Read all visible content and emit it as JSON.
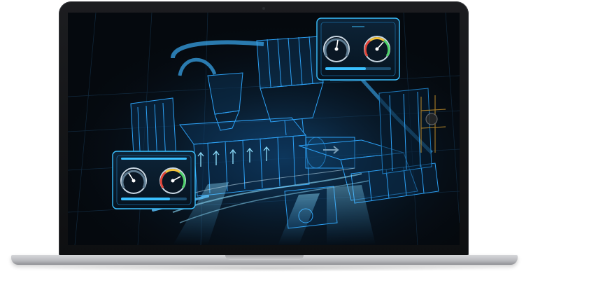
{
  "scene": {
    "subject": "laptop-mockup",
    "screen_content": "industrial-machine-hologram",
    "colors": {
      "screen_bg": "#05090e",
      "hologram": "#2fa8ff",
      "hologram_bright": "#8fe0ff",
      "gauge_red": "#e2463a",
      "gauge_green": "#4ed36a",
      "gauge_yellow": "#f2c23b",
      "laptop_body": "#c4c5c8"
    },
    "dashboards": [
      {
        "name": "top-right-panel",
        "gauge_count": 2
      },
      {
        "name": "bottom-left-panel",
        "gauge_count": 2
      }
    ]
  }
}
